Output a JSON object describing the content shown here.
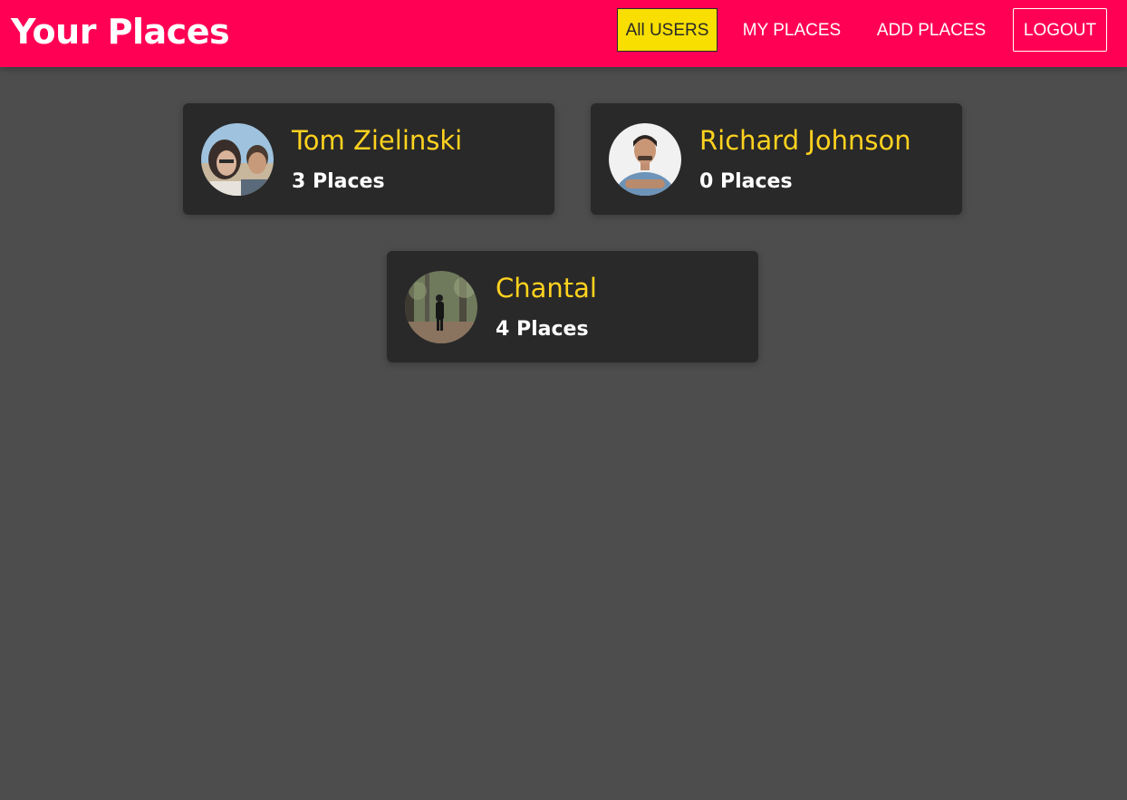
{
  "header": {
    "title": "Your Places"
  },
  "nav": {
    "items": [
      {
        "label": "All USERS",
        "active": true
      },
      {
        "label": "MY PLACES",
        "active": false
      },
      {
        "label": "ADD PLACES",
        "active": false
      },
      {
        "label": "LOGOUT",
        "active": false
      }
    ]
  },
  "users": [
    {
      "name": "Tom Zielinski",
      "places": "3 Places",
      "avatar_icon": "user-photo-couple"
    },
    {
      "name": "Richard Johnson",
      "places": "0 Places",
      "avatar_icon": "user-photo-man"
    },
    {
      "name": "Chantal",
      "places": "4 Places",
      "avatar_icon": "user-photo-forest"
    }
  ],
  "colors": {
    "header_bg": "#ff0055",
    "page_bg": "#4d4d4d",
    "card_bg": "#292929",
    "accent_yellow": "#ffd21f",
    "active_nav_bg": "#f8df00"
  }
}
